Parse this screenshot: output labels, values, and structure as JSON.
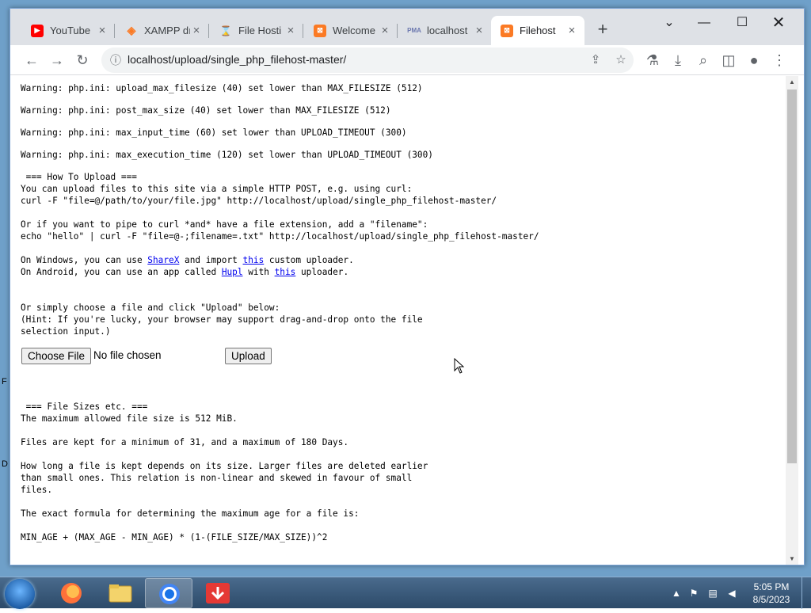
{
  "browser": {
    "tabs": [
      {
        "title": "YouTube",
        "icon": "youtube-icon",
        "color": "#ff0000"
      },
      {
        "title": "XAMPP dı",
        "icon": "xampp-icon",
        "color": "#fb7a24"
      },
      {
        "title": "File Hosti",
        "icon": "file-icon",
        "color": "#555555"
      },
      {
        "title": "Welcome",
        "icon": "xampp-icon",
        "color": "#fb7a24"
      },
      {
        "title": "localhost",
        "icon": "phpmyadmin-icon",
        "color": "#f89c0e"
      },
      {
        "title": "Filehost",
        "icon": "xampp-icon",
        "color": "#fb7a24",
        "active": true
      }
    ],
    "new_tab_label": "+",
    "url": "localhost/upload/single_php_filehost-master/"
  },
  "page": {
    "warnings": [
      "Warning: php.ini: upload_max_filesize (40) set lower than MAX_FILESIZE (512)",
      "Warning: php.ini: post_max_size (40) set lower than MAX_FILESIZE (512)",
      "Warning: php.ini: max_input_time (60) set lower than UPLOAD_TIMEOUT (300)",
      "Warning: php.ini: max_execution_time (120) set lower than UPLOAD_TIMEOUT (300)"
    ],
    "howto_heading": " === How To Upload ===",
    "howto_line1": "You can upload files to this site via a simple HTTP POST, e.g. using curl:",
    "howto_line2": "curl -F \"file=@/path/to/your/file.jpg\" http://localhost/upload/single_php_filehost-master/",
    "pipe_line1": "Or if you want to pipe to curl *and* have a file extension, add a \"filename\":",
    "pipe_line2": "echo \"hello\" | curl -F \"file=@-;filename=.txt\" http://localhost/upload/single_php_filehost-master/",
    "windows_pre": "On Windows, you can use ",
    "sharex_link": "ShareX",
    "windows_mid": " and import ",
    "this_link": "this",
    "windows_post": " custom uploader.",
    "android_pre": "On Android, you can use an app called ",
    "hupl_link": "Hupl",
    "android_mid": " with ",
    "android_post": " uploader.",
    "choose_line": "Or simply choose a file and click \"Upload\" below:",
    "hint_line1": "(Hint: If you're lucky, your browser may support drag-and-drop onto the file",
    "hint_line2": "selection input.)",
    "choose_file_button": "Choose File",
    "no_file_text": "No file chosen",
    "upload_button": "Upload",
    "sizes_heading": " === File Sizes etc. ===",
    "max_size_line": "The maximum allowed file size is 512 MiB.",
    "kept_line": "Files are kept for a minimum of 31, and a maximum of 180 Days.",
    "how_long_line1": "How long a file is kept depends on its size. Larger files are deleted earlier",
    "how_long_line2": "than small ones. This relation is non-linear and skewed in favour of small",
    "how_long_line3": "files.",
    "formula_intro": "The exact formula for determining the maximum age for a file is:",
    "formula": "MIN_AGE + (MAX_AGE - MIN_AGE) * (1-(FILE_SIZE/MAX_SIZE))^2"
  },
  "taskbar": {
    "time": "5:05 PM",
    "date": "8/5/2023"
  }
}
